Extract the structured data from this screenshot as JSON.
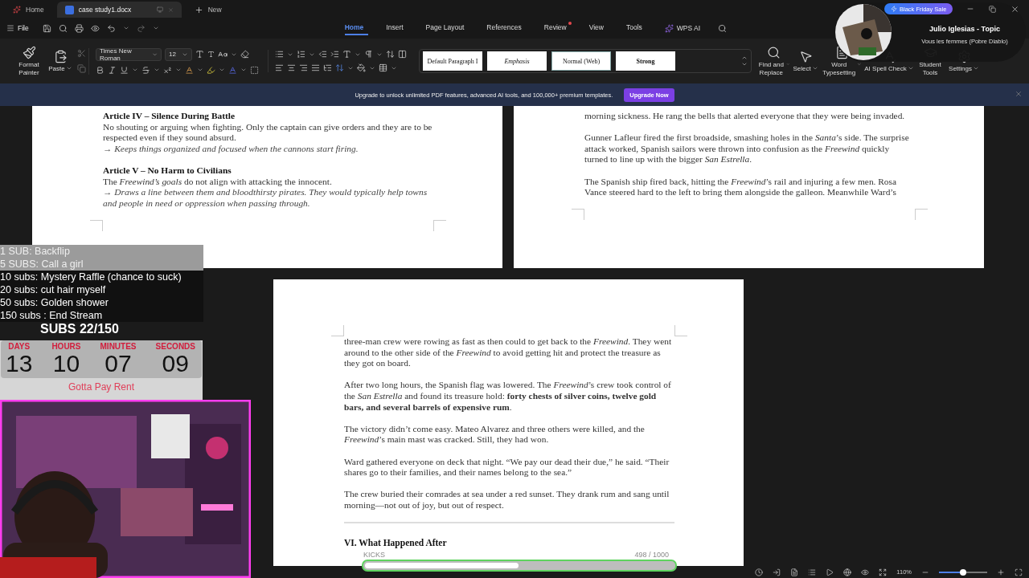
{
  "tabs": [
    {
      "label": "Home",
      "kind": "home",
      "selected": false
    },
    {
      "label": "case study1.docx",
      "kind": "doc",
      "selected": true
    },
    {
      "label": "New",
      "kind": "new",
      "selected": false
    }
  ],
  "promo_badge": "Black Friday Sale",
  "now_playing": {
    "artist": "Julio Iglesias - Topic",
    "song": "Vous les femmes (Pobre Diablo)"
  },
  "menu": {
    "file": "File",
    "ai": "WPS AI",
    "tabs": [
      {
        "label": "Home",
        "selected": true,
        "notification": false
      },
      {
        "label": "Insert",
        "selected": false,
        "notification": false
      },
      {
        "label": "Page Layout",
        "selected": false,
        "notification": false
      },
      {
        "label": "References",
        "selected": false,
        "notification": false
      },
      {
        "label": "Review",
        "selected": false,
        "notification": true
      },
      {
        "label": "View",
        "selected": false,
        "notification": false
      },
      {
        "label": "Tools",
        "selected": false,
        "notification": false
      }
    ]
  },
  "ribbon": {
    "clipboard": [
      {
        "label": "Format Painter",
        "kind": "painter",
        "dropdown": false
      },
      {
        "label": "Paste",
        "kind": "paste",
        "dropdown": true
      }
    ],
    "font": "Times New Roman",
    "size": "12",
    "styles": [
      {
        "label": "Default Paragraph I",
        "kind": "plain",
        "selected": false
      },
      {
        "label": "Emphasis",
        "kind": "italic",
        "selected": false
      },
      {
        "label": "Normal (Web)",
        "kind": "plain",
        "selected": true
      },
      {
        "label": "Strong",
        "kind": "bold",
        "selected": false
      }
    ],
    "tools": [
      {
        "label": "Find and Replace",
        "kind": "find",
        "dropdown": true
      },
      {
        "label": "Select",
        "kind": "select",
        "dropdown": true
      },
      {
        "label": "Word Typesetting",
        "kind": "typeset",
        "dropdown": true
      },
      {
        "label": "AI Spell Check",
        "kind": "spell",
        "dropdown": true
      },
      {
        "label": "Student Tools",
        "kind": "student",
        "dropdown": false
      },
      {
        "label": "Settings",
        "kind": "settings",
        "dropdown": true
      }
    ]
  },
  "banner": {
    "text": "Upgrade to unlock unlimited PDF features, advanced AI tools, and 100,000+ premium templates.",
    "button": "Upgrade Now"
  },
  "pages": [
    {
      "blocks": [
        {
          "kind": "heading",
          "text": "Article IV – Silence During Battle"
        },
        {
          "kind": "body",
          "text": "No shouting or arguing when fighting. Only the captain can give orders and they are to be respected even if they sound absurd."
        },
        {
          "kind": "note",
          "text": "→ Keeps things organized and focused when the cannons start firing."
        },
        {
          "kind": "heading",
          "text": "Article V – No Harm to Civilians"
        },
        {
          "kind": "body",
          "text": "The *Freewind’s goals* do not align with attacking the innocent."
        },
        {
          "kind": "note",
          "text": "→ Draws a line between them and bloodthirsty pirates. They would typically help towns and people in need or oppression when passing through."
        }
      ]
    },
    {
      "blocks": [
        {
          "kind": "para",
          "text": "morning sickness. He rang the bells that alerted everyone that they were being invaded."
        },
        {
          "kind": "para",
          "text": "Gunner Lafleur fired the first broadside, smashing holes in the *Santa*’s side. The surprise attack worked, Spanish sailors were thrown into confusion as the *Freewind* quickly turned to line up with the bigger *San Estrella*."
        },
        {
          "kind": "para",
          "text": "The Spanish ship fired back, hitting the *Freewind*’s rail and injuring a few men. Rosa Vance steered hard to the left to bring them alongside the galleon. Meanwhile Ward’s"
        }
      ]
    },
    {
      "blocks": [
        {
          "kind": "para",
          "text": "three-man crew were rowing as fast as then could to get back to the *Freewind*. They went around to the other side of the *Freewind* to avoid getting hit and protect the treasure as they got on board."
        },
        {
          "kind": "para",
          "text": "After two long hours, the Spanish flag was lowered. The *Freewind*’s crew took control of the *San Estrella* and found its treasure hold: **forty chests of silver coins, twelve gold bars, and several barrels of expensive rum**."
        },
        {
          "kind": "para",
          "text": "The victory didn’t come easy. Mateo Alvarez and three others were killed, and the *Freewind*’s main mast was cracked. Still, they had won."
        },
        {
          "kind": "para",
          "text": "Ward gathered everyone on deck that night. “We pay our dead their due,” he said. “Their shares go to their families, and their names belong to the sea.”"
        },
        {
          "kind": "para",
          "text": "The crew buried their comrades at sea under a red sunset. They drank rum and sang until morning—not out of joy, but out of respect."
        },
        {
          "kind": "rule"
        },
        {
          "kind": "heading2",
          "text": "VI. What Happened After"
        }
      ]
    }
  ],
  "status": {
    "zoom": "110%",
    "level": 0.5
  },
  "stream": {
    "goals": [
      {
        "text": "1 SUB: Backflip",
        "dim": true
      },
      {
        "text": "5 SUBS: Call a girl",
        "dim": true
      },
      {
        "text": "10 subs: Mystery Raffle (chance to suck)",
        "dim": false
      },
      {
        "text": "20 subs: cut hair myself",
        "dim": false
      },
      {
        "text": "50 subs: Golden shower",
        "dim": false
      },
      {
        "text": "150 subs : End Stream",
        "dim": false
      }
    ],
    "subs": "SUBS 22/150",
    "countdown": [
      {
        "label": "DAYS",
        "value": "13"
      },
      {
        "label": "HOURS",
        "value": "10"
      },
      {
        "label": "MINUTES",
        "value": "07"
      },
      {
        "label": "SECONDS",
        "value": "09"
      }
    ],
    "caption": "Gotta Pay Rent",
    "kicks": {
      "label": "KICKS",
      "reading": "498 / 1000",
      "level": 0.498
    }
  }
}
